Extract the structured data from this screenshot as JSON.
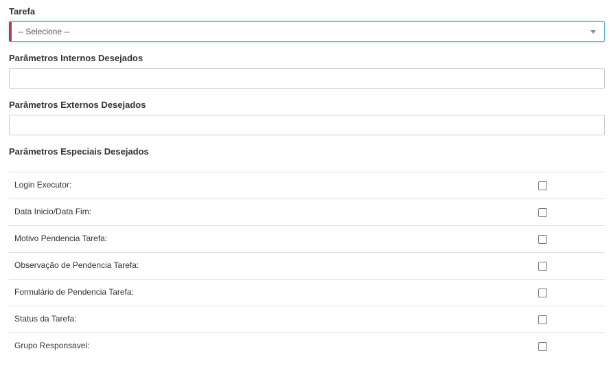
{
  "tarefa": {
    "label": "Tarefa",
    "selected": "-- Selecione --"
  },
  "internos": {
    "label": "Parâmetros Internos Desejados",
    "value": ""
  },
  "externos": {
    "label": "Parâmetros Externos Desejados",
    "value": ""
  },
  "especiais": {
    "label": "Parâmetros Especiais Desejados",
    "rows": [
      {
        "label": "Login Executor:",
        "checked": false
      },
      {
        "label": "Data Inicio/Data Fim:",
        "checked": false
      },
      {
        "label": "Motivo Pendencia Tarefa:",
        "checked": false
      },
      {
        "label": "Observação de Pendencia Tarefa:",
        "checked": false
      },
      {
        "label": "Formulário de Pendencia Tarefa:",
        "checked": false
      },
      {
        "label": "Status da Tarefa:",
        "checked": false
      },
      {
        "label": "Grupo Responsavel:",
        "checked": false
      }
    ]
  },
  "colors": {
    "required_marker": "#a94442",
    "focus_border": "#66afe9"
  },
  "icons": {
    "dropdown": "caret-down-icon"
  }
}
